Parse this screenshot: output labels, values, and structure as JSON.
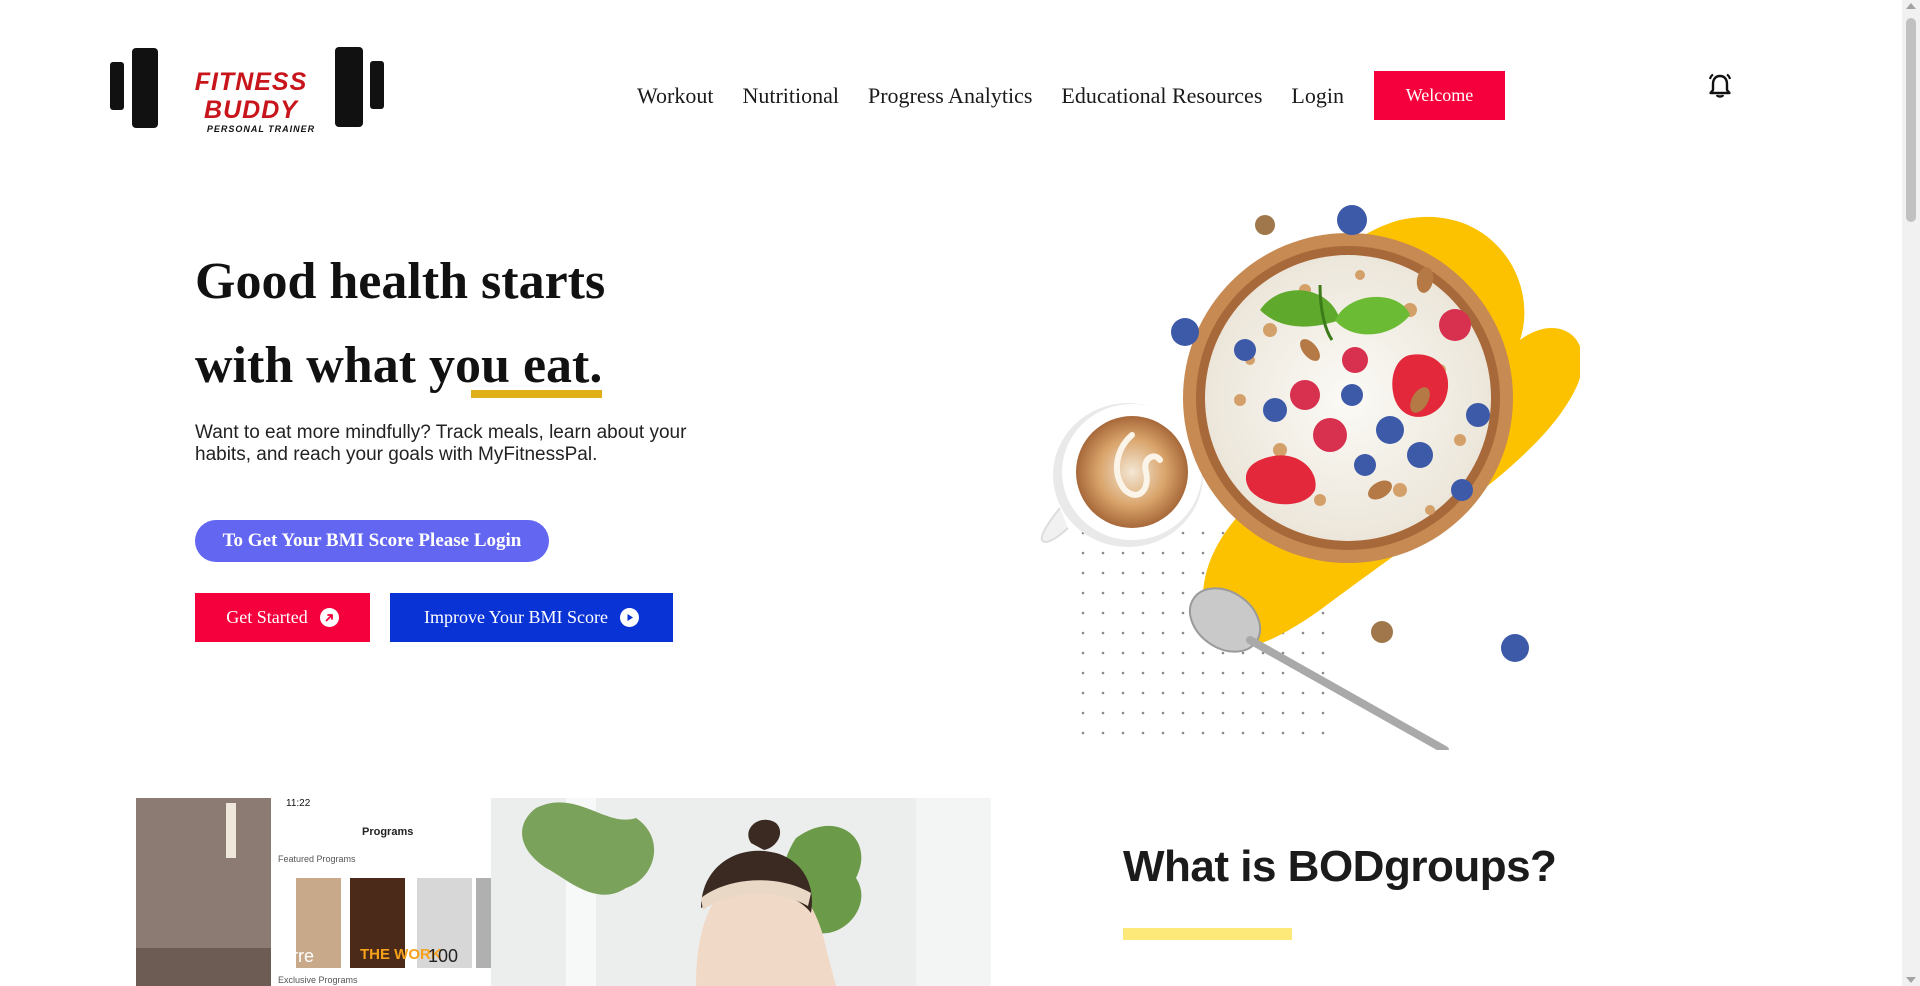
{
  "brand": {
    "title": "FITNESS BUDDY",
    "subtitle": "PERSONAL TRAINER"
  },
  "nav": {
    "links": [
      "Workout",
      "Nutritional",
      "Progress Analytics",
      "Educational Resources",
      "Login"
    ],
    "welcome_label": "Welcome"
  },
  "hero": {
    "title_line1": "Good health starts",
    "title_line2_prefix": "with what yo",
    "title_line2_highlight": "u eat.",
    "description": "Want to eat more mindfully? Track meals, learn about your habits, and reach your goals with MyFitnessPal.",
    "bmi_login_label": "To Get Your BMI Score Please Login",
    "get_started_label": "Get Started",
    "improve_bmi_label": "Improve Your BMI Score"
  },
  "video": {
    "time": "11:22",
    "header": "Programs",
    "featured_label": "Featured Programs",
    "exclusive_label": "Exclusive Programs",
    "cards": [
      "barre",
      "THE WORK",
      "100"
    ]
  },
  "about": {
    "title": "What is BODgroups?"
  },
  "colors": {
    "accent_red": "#f5003c",
    "accent_blue": "#0a33d6",
    "accent_purple": "#6366f1",
    "highlight_yellow": "#e0b019",
    "logo_red": "#c8151b",
    "bar_yellow": "#fde97a"
  },
  "icons": {
    "bell": "bell-icon",
    "get_started": "arrow-up-right-icon",
    "improve": "play-icon"
  }
}
